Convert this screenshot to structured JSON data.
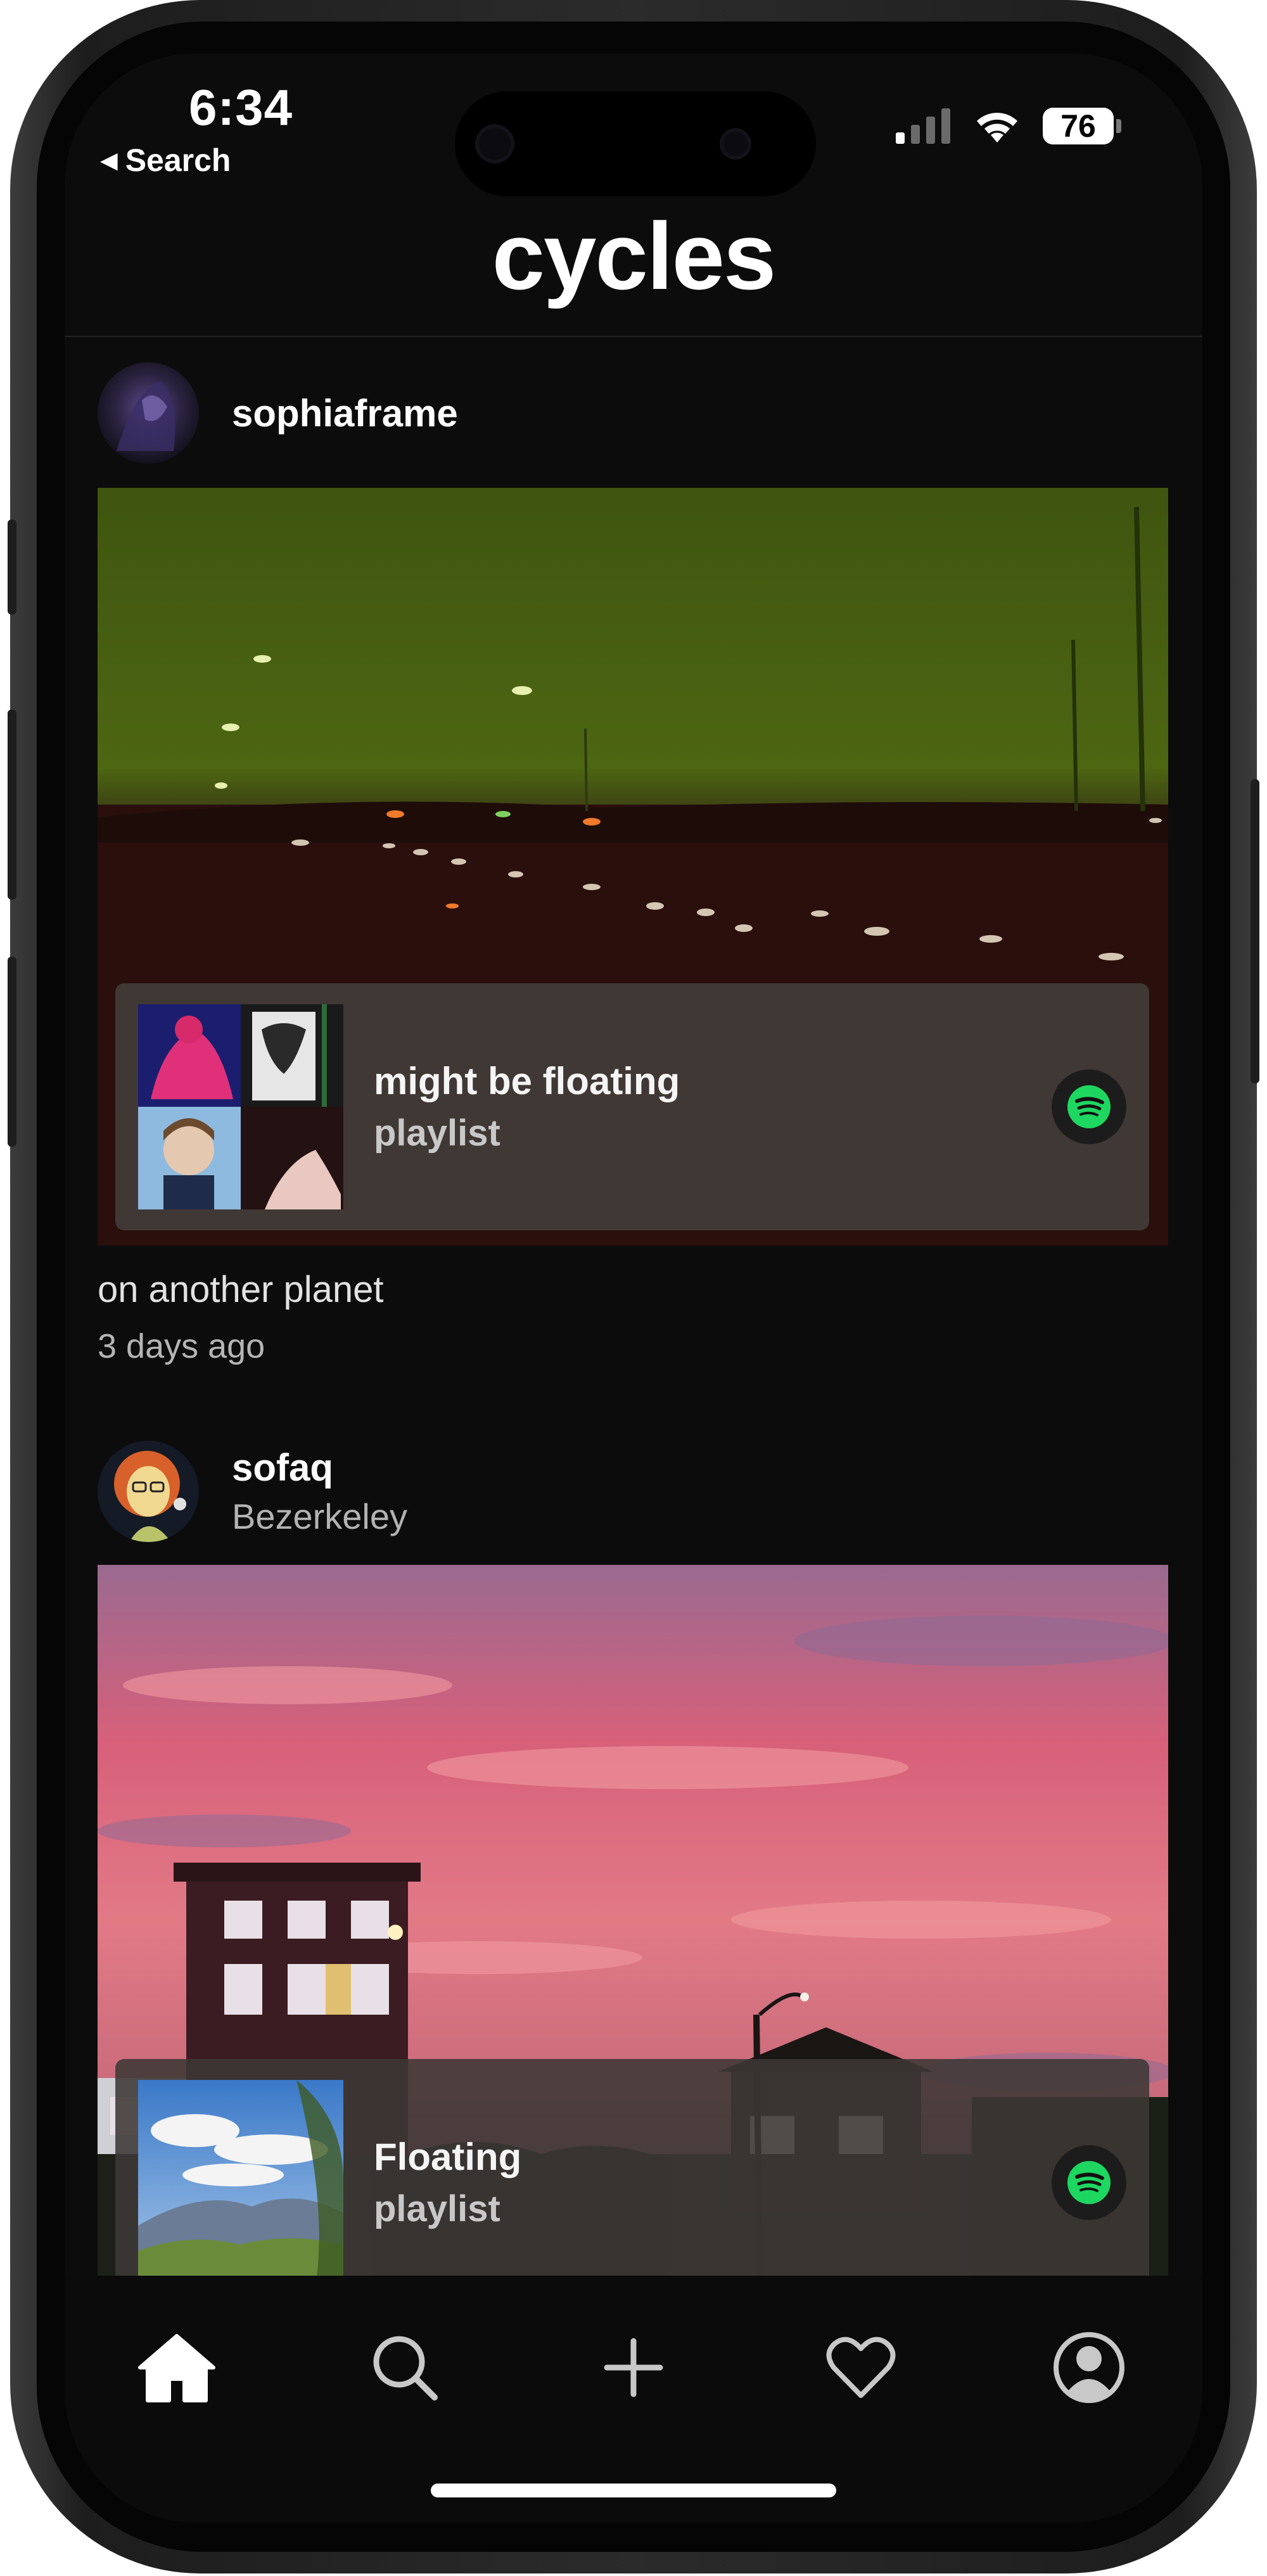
{
  "status_bar": {
    "time": "6:34",
    "back_label": "Search",
    "battery": "76"
  },
  "app": {
    "title": "cycles"
  },
  "posts": [
    {
      "username": "sophiaframe",
      "location": "",
      "playlist": {
        "title": "might be floating",
        "type": "playlist",
        "service_icon": "spotify-icon"
      },
      "caption": "on another planet",
      "time_ago": "3 days ago"
    },
    {
      "username": "sofaq",
      "location": "Bezerkeley",
      "playlist": {
        "title": "Floating",
        "type": "playlist",
        "service_icon": "spotify-icon"
      }
    }
  ],
  "tab_bar": {
    "items": [
      {
        "icon": "home-icon",
        "active": true
      },
      {
        "icon": "search-icon",
        "active": false
      },
      {
        "icon": "plus-icon",
        "active": false
      },
      {
        "icon": "heart-icon",
        "active": false
      },
      {
        "icon": "profile-icon",
        "active": false
      }
    ]
  },
  "colors": {
    "background": "#0c0c0c",
    "card": "#423c3a",
    "spotify": "#1ed760",
    "text": "#ffffff",
    "muted": "#b3b3b3"
  }
}
